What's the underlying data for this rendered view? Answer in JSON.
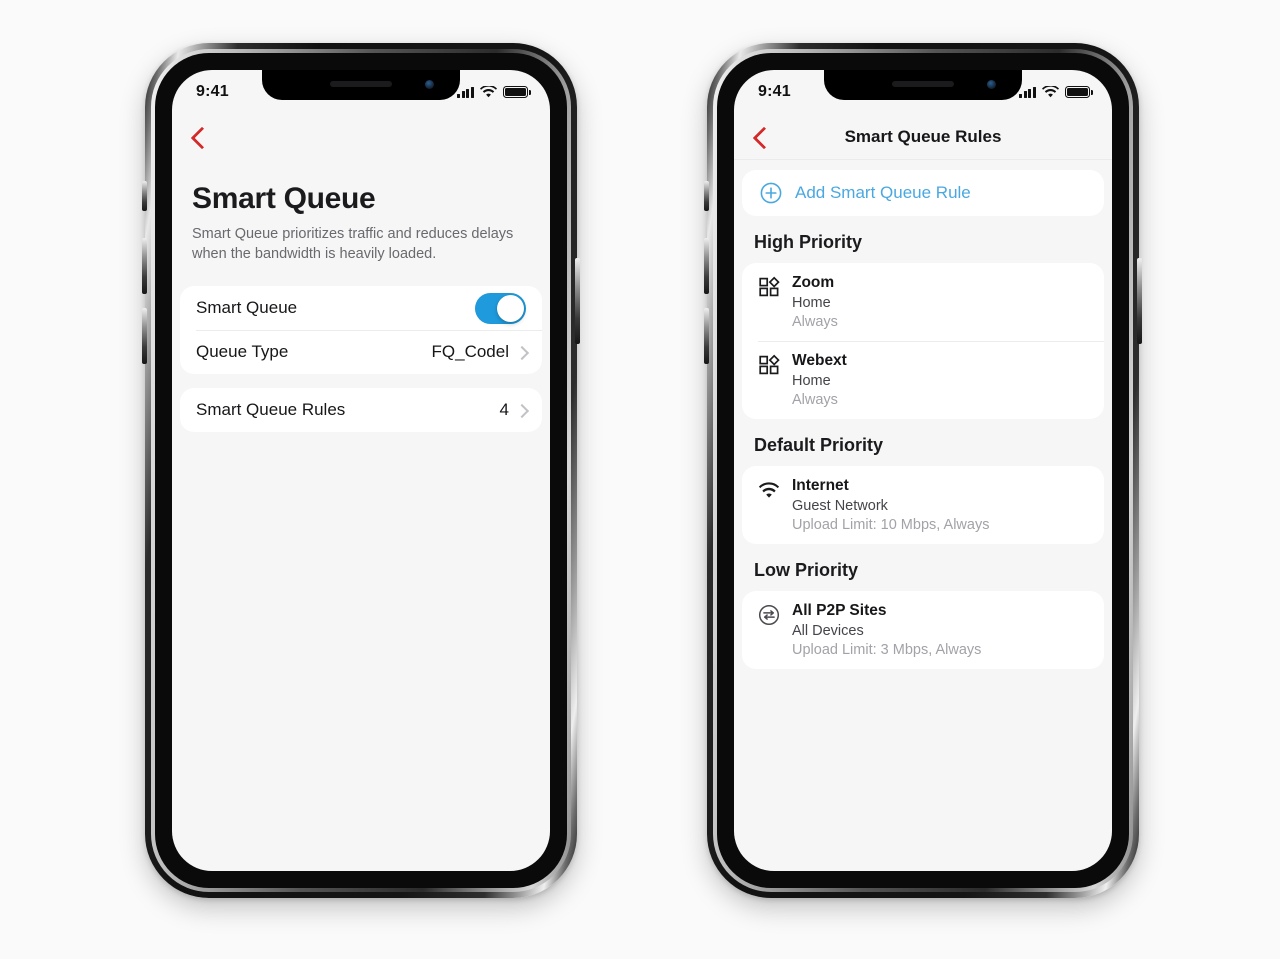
{
  "theme": {
    "accent_blue": "#1f9bdd",
    "link_blue": "#4aa8e0",
    "back_red": "#d42a2a",
    "page_bg": "#fafafa",
    "screen_bg": "#f6f6f7"
  },
  "phone_left": {
    "status_bar": {
      "time": "9:41",
      "signal_icon": "cellular-bars-icon",
      "wifi_icon": "wifi-icon",
      "battery_icon": "battery-full-icon"
    },
    "back_icon": "chevron-left-icon",
    "title": "Smart Queue",
    "description": "Smart Queue prioritizes traffic and reduces delays when the bandwidth is heavily loaded.",
    "group_one": [
      {
        "label": "Smart Queue",
        "control": "toggle",
        "toggle_on": true,
        "value": ""
      },
      {
        "label": "Queue Type",
        "control": "disclosure",
        "value": "FQ_Codel",
        "chevron_icon": "chevron-right-icon"
      }
    ],
    "group_two": [
      {
        "label": "Smart Queue Rules",
        "control": "disclosure",
        "value": "4",
        "chevron_icon": "chevron-right-icon"
      }
    ]
  },
  "phone_right": {
    "status_bar": {
      "time": "9:41",
      "signal_icon": "cellular-bars-icon",
      "wifi_icon": "wifi-icon",
      "battery_icon": "battery-full-icon"
    },
    "back_icon": "chevron-left-icon",
    "nav_title": "Smart Queue Rules",
    "add_rule": {
      "label": "Add Smart Queue Rule",
      "icon": "plus-circle-icon"
    },
    "sections": [
      {
        "header": "High Priority",
        "rules": [
          {
            "icon": "apps-grid-icon",
            "name": "Zoom",
            "target": "Home",
            "schedule": "Always"
          },
          {
            "icon": "apps-grid-icon",
            "name": "Webext",
            "target": "Home",
            "schedule": "Always"
          }
        ]
      },
      {
        "header": "Default Priority",
        "rules": [
          {
            "icon": "wifi-icon",
            "name": "Internet",
            "target": "Guest Network",
            "schedule": "Upload Limit: 10 Mbps, Always"
          }
        ]
      },
      {
        "header": "Low Priority",
        "rules": [
          {
            "icon": "p2p-transfer-icon",
            "name": "All P2P Sites",
            "target": "All Devices",
            "schedule": "Upload Limit: 3 Mbps, Always"
          }
        ]
      }
    ]
  }
}
